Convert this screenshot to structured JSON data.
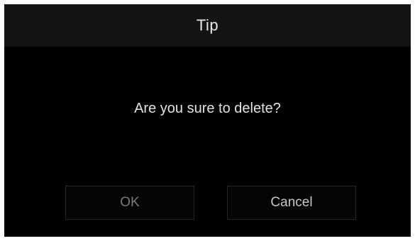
{
  "dialog": {
    "title": "Tip",
    "message": "Are you sure to delete?",
    "ok_label": "OK",
    "cancel_label": "Cancel"
  },
  "colors": {
    "background": "#000000",
    "titlebar": "#141414",
    "text": "#e6e6e6",
    "ok_text": "#7a7a7a",
    "cancel_text": "#c8c8c8",
    "button_border": "#262626"
  }
}
